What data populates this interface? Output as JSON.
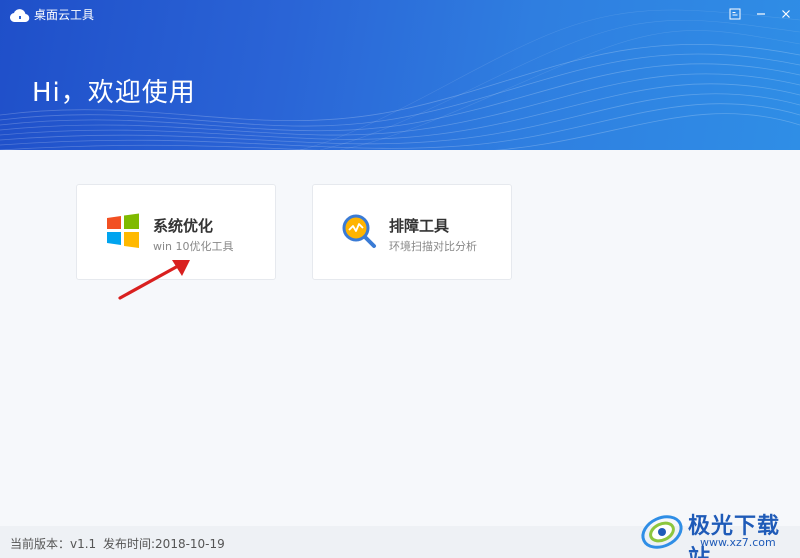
{
  "window": {
    "title": "桌面云工具",
    "controls": {
      "menu_icon": "menu-icon",
      "minimize_icon": "minimize-icon",
      "close_icon": "close-icon"
    }
  },
  "header": {
    "greeting": "Hi，欢迎使用",
    "colors": {
      "gradient_start": "#1f4fc9",
      "gradient_end": "#2f8ee6"
    }
  },
  "tools": [
    {
      "title": "系统优化",
      "subtitle": "win 10优化工具",
      "icon": "windows-logo-icon"
    },
    {
      "title": "排障工具",
      "subtitle": "环境扫描对比分析",
      "icon": "magnifier-chart-icon"
    }
  ],
  "annotation": {
    "icon": "red-arrow-icon",
    "color": "#d9201f"
  },
  "footer": {
    "version": "当前版本：v1.1",
    "release": "发布时间:2018-10-19"
  },
  "watermark": {
    "name": "极光下载站",
    "url": "www.xz7.com"
  }
}
